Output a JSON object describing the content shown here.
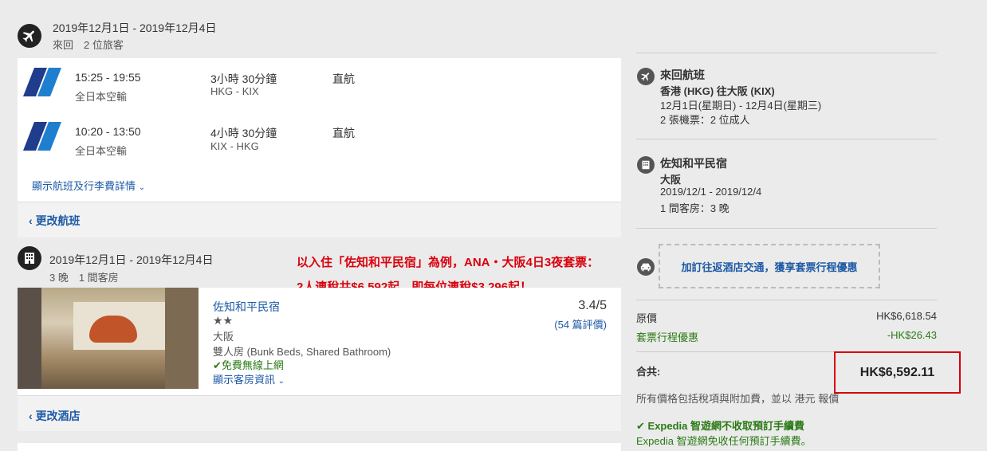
{
  "flight_section": {
    "dates": "2019年12月1日 - 2019年12月4日",
    "subtitle": "來回　2 位旅客",
    "legs": [
      {
        "time": "15:25 - 19:55",
        "airline": "全日本空輸",
        "duration": "3小時 30分鐘",
        "route": "HKG - KIX",
        "stops": "直航"
      },
      {
        "time": "10:20 - 13:50",
        "airline": "全日本空輸",
        "duration": "4小時 30分鐘",
        "route": "KIX - HKG",
        "stops": "直航"
      }
    ],
    "details_link": "顯示航班及行李費詳情 ",
    "change_link": "更改航班"
  },
  "hotel_section": {
    "dates": "2019年12月1日 - 2019年12月4日",
    "subtitle": "3 晚　1 間客房",
    "name": "佐知和平民宿",
    "stars": "★★",
    "location": "大阪",
    "room": "雙人房 (Bunk Beds, Shared Bathroom)",
    "wifi": "免費無線上網",
    "rating": "3.4/5",
    "reviews": "(54 篇評價)",
    "room_info_link": "顯示客房資訊 ",
    "change_link": "更改酒店"
  },
  "promo_overlay": {
    "line1": "以入住「佐知和平民宿」為例，ANA・大阪4日3夜套票：",
    "line2": "2人連稅共$6,592起、即每位連稅$3,296起！"
  },
  "summary": {
    "flight": {
      "title": "來回航班",
      "route": "香港 (HKG) 往大阪 (KIX)",
      "dates": "12月1日(星期日) - 12月4日(星期三)",
      "tickets": "2 張機票：2 位成人"
    },
    "hotel": {
      "title": "佐知和平民宿",
      "city": "大阪",
      "dates": "2019/12/1 - 2019/12/4",
      "rooms": "1 間客房：3 晚"
    },
    "transfer_link": "加訂往返酒店交通，獲享套票行程優惠",
    "original_label": "原價",
    "original_value": "HK$6,618.54",
    "discount_label": "套票行程優惠",
    "discount_value": "-HK$26.43",
    "total_label": "合共:",
    "total_value": "HK$6,592.11",
    "tax_note": "所有價格包括稅項與附加費，並以 港元 報價",
    "fee_title": "Expedia 智遊網不收取預訂手續費",
    "fee_note": "Expedia 智遊網免收任何預訂手續費。"
  },
  "colors": {
    "accent_red": "#d9000c",
    "link_blue": "#1e5aa6",
    "green": "#2a7a14",
    "ana_blue": "#1f3d8c"
  }
}
